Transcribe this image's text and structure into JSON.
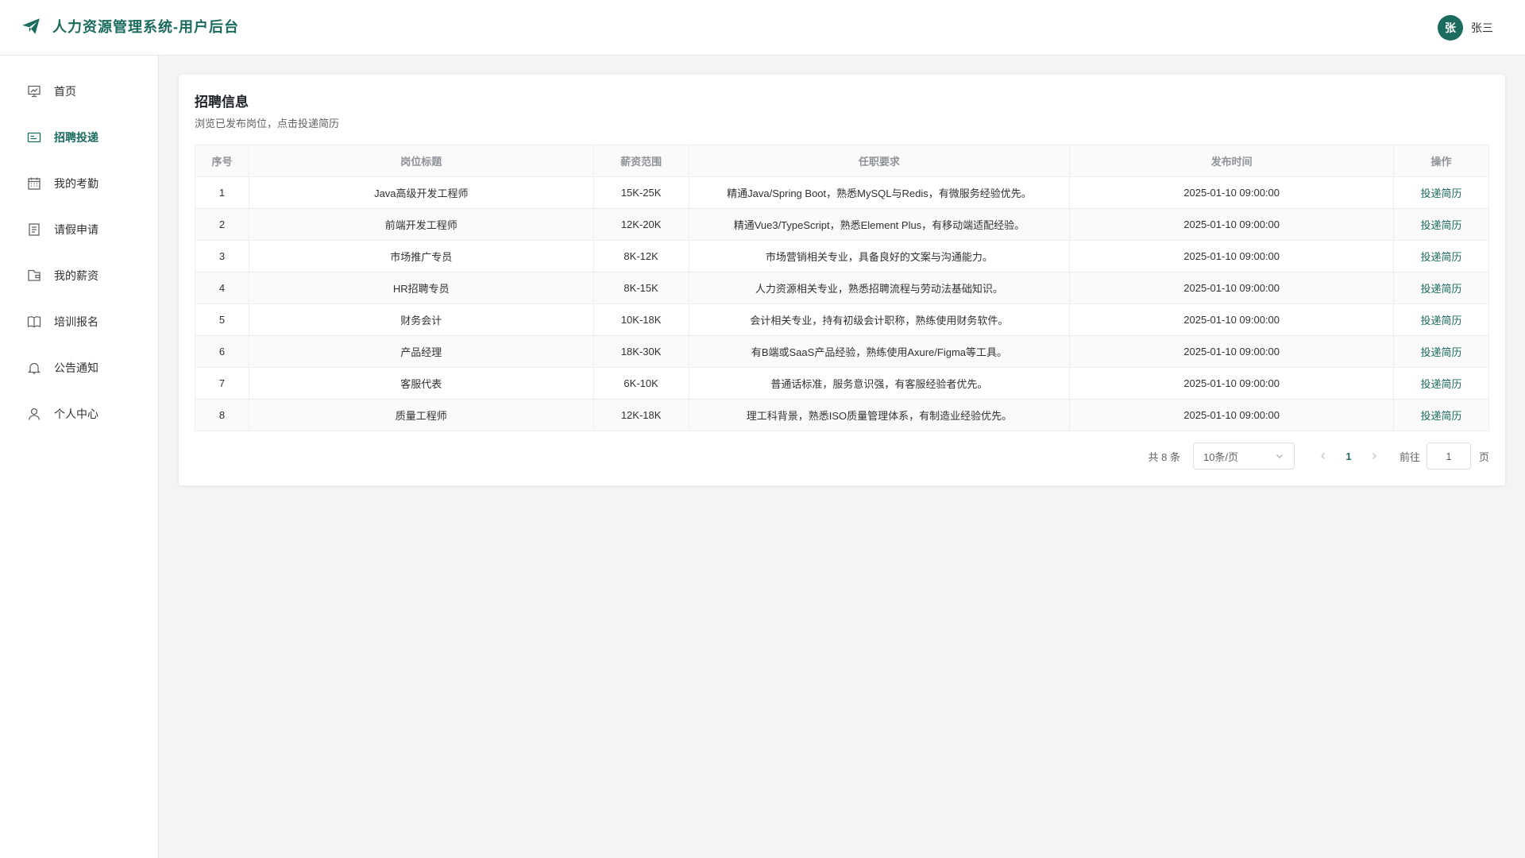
{
  "app": {
    "title": "人力资源管理系统-用户后台"
  },
  "user": {
    "avatar_initial": "张",
    "name": "张三"
  },
  "colors": {
    "accent": "#1b6b5f"
  },
  "sidebar": {
    "items": [
      {
        "label": "首页",
        "icon": "presentation-chart-icon",
        "active": false
      },
      {
        "label": "招聘投递",
        "icon": "id-card-icon",
        "active": true
      },
      {
        "label": "我的考勤",
        "icon": "calendar-icon",
        "active": false
      },
      {
        "label": "请假申请",
        "icon": "document-icon",
        "active": false
      },
      {
        "label": "我的薪资",
        "icon": "wallet-icon",
        "active": false
      },
      {
        "label": "培训报名",
        "icon": "book-icon",
        "active": false
      },
      {
        "label": "公告通知",
        "icon": "bell-icon",
        "active": false
      },
      {
        "label": "个人中心",
        "icon": "user-icon",
        "active": false
      }
    ]
  },
  "main": {
    "title": "招聘信息",
    "subtitle": "浏览已发布岗位，点击投递简历",
    "table": {
      "columns": [
        "序号",
        "岗位标题",
        "薪资范围",
        "任职要求",
        "发布时间",
        "操作"
      ],
      "rows": [
        [
          "1",
          "Java高级开发工程师",
          "15K-25K",
          "精通Java/Spring Boot，熟悉MySQL与Redis，有微服务经验优先。",
          "2025-01-10 09:00:00",
          "投递简历"
        ],
        [
          "2",
          "前端开发工程师",
          "12K-20K",
          "精通Vue3/TypeScript，熟悉Element Plus，有移动端适配经验。",
          "2025-01-10 09:00:00",
          "投递简历"
        ],
        [
          "3",
          "市场推广专员",
          "8K-12K",
          "市场营销相关专业，具备良好的文案与沟通能力。",
          "2025-01-10 09:00:00",
          "投递简历"
        ],
        [
          "4",
          "HR招聘专员",
          "8K-15K",
          "人力资源相关专业，熟悉招聘流程与劳动法基础知识。",
          "2025-01-10 09:00:00",
          "投递简历"
        ],
        [
          "5",
          "财务会计",
          "10K-18K",
          "会计相关专业，持有初级会计职称，熟练使用财务软件。",
          "2025-01-10 09:00:00",
          "投递简历"
        ],
        [
          "6",
          "产品经理",
          "18K-30K",
          "有B端或SaaS产品经验，熟练使用Axure/Figma等工具。",
          "2025-01-10 09:00:00",
          "投递简历"
        ],
        [
          "7",
          "客服代表",
          "6K-10K",
          "普通话标准，服务意识强，有客服经验者优先。",
          "2025-01-10 09:00:00",
          "投递简历"
        ],
        [
          "8",
          "质量工程师",
          "12K-18K",
          "理工科背景，熟悉ISO质量管理体系，有制造业经验优先。",
          "2025-01-10 09:00:00",
          "投递简历"
        ]
      ]
    },
    "pagination": {
      "total": "共 8 条",
      "page_size": "10条/页",
      "current_page": "1",
      "goto_label": "前往",
      "goto_value": "1",
      "page_unit": "页"
    }
  }
}
